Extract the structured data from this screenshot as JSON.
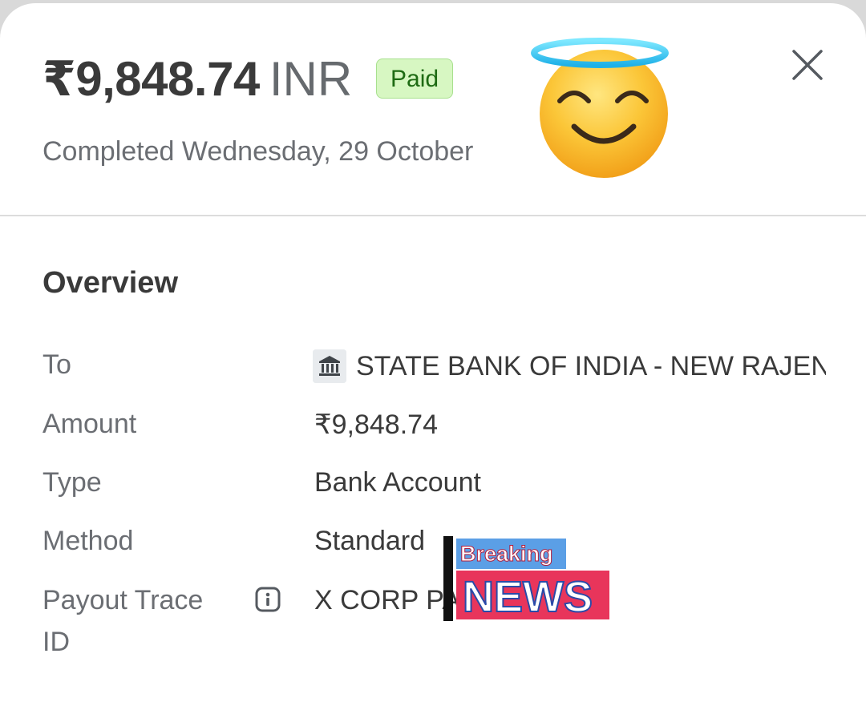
{
  "header": {
    "amount": "₹9,848.74",
    "currency": "INR",
    "status_badge": "Paid",
    "completed": "Completed Wednesday, 29 October"
  },
  "overview": {
    "title": "Overview",
    "rows": {
      "to": {
        "label": "To",
        "value": "STATE BANK OF INDIA - NEW RAJENDRA NAGAR",
        "icon": "bank-icon"
      },
      "amount": {
        "label": "Amount",
        "value": "₹9,848.74"
      },
      "type": {
        "label": "Type",
        "value": "Bank Account"
      },
      "method": {
        "label": "Method",
        "value": "Standard"
      },
      "payout_trace": {
        "label_line1": "Payout Trace",
        "label_line2": "ID",
        "value": "X CORP PA",
        "icon": "info-icon"
      }
    }
  },
  "sticker": {
    "top": "Breaking",
    "bottom": "NEWS"
  },
  "colors": {
    "badge_bg": "#d7f7c2",
    "badge_text": "#1e6b13",
    "text_primary": "#3a3a3a",
    "text_secondary": "#6b6e73"
  }
}
